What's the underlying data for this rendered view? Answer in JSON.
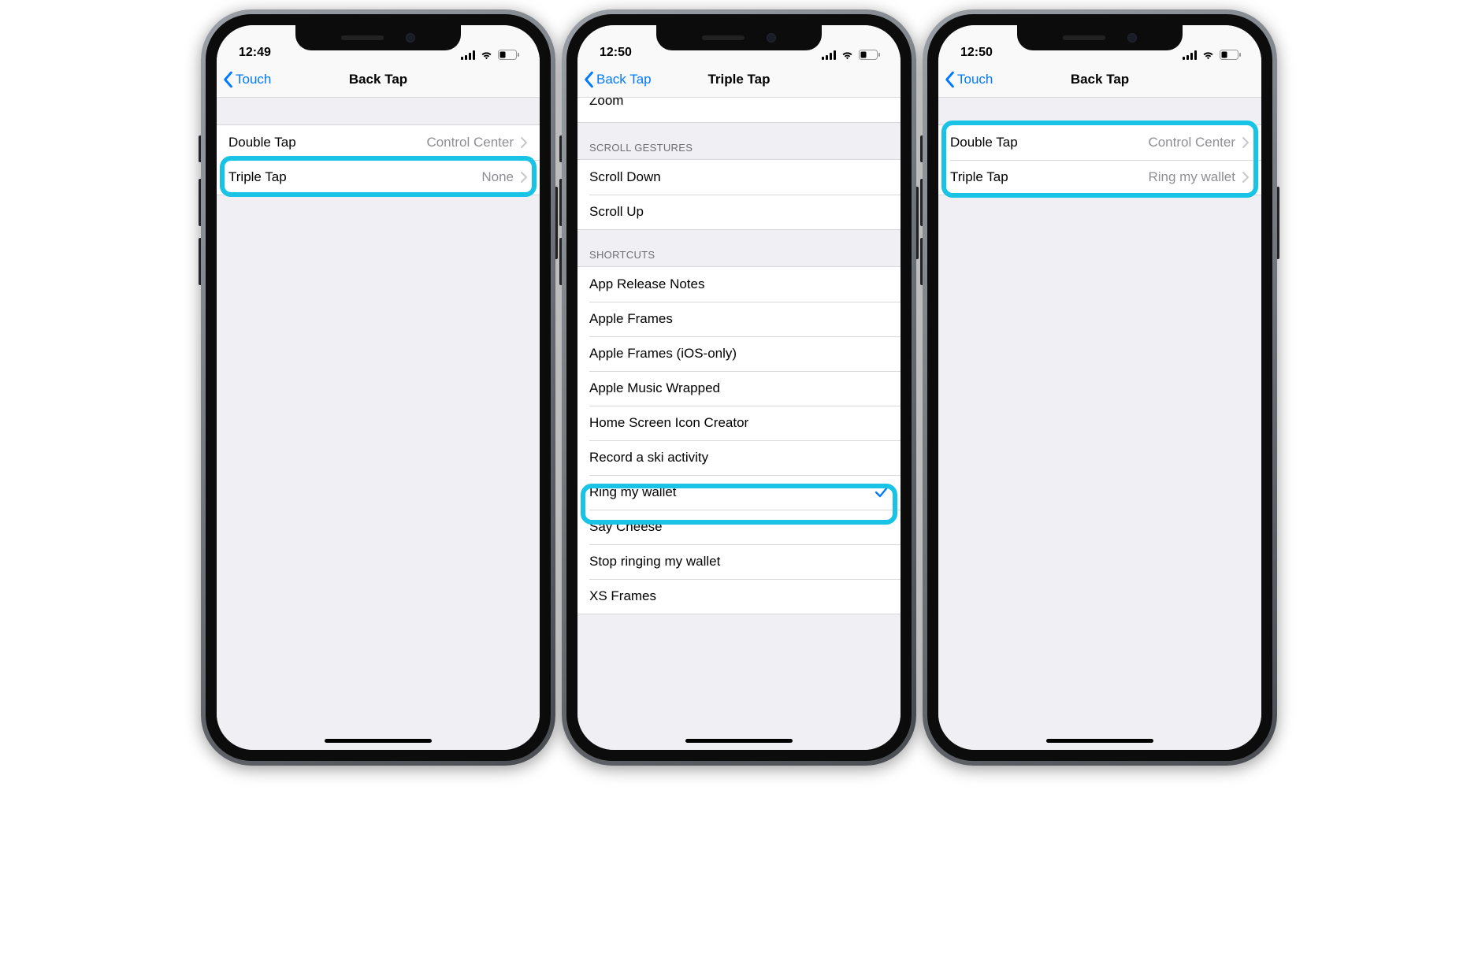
{
  "phones": [
    {
      "time": "12:49",
      "back_label": "Touch",
      "title": "Back Tap",
      "rows": [
        {
          "label": "Double Tap",
          "value": "Control Center"
        },
        {
          "label": "Triple Tap",
          "value": "None"
        }
      ]
    },
    {
      "time": "12:50",
      "back_label": "Back Tap",
      "title": "Triple Tap",
      "partial_top": "Zoom",
      "sections": [
        {
          "header": "Scroll Gestures",
          "items": [
            "Scroll Down",
            "Scroll Up"
          ]
        },
        {
          "header": "Shortcuts",
          "items": [
            "App Release Notes",
            "Apple Frames",
            "Apple Frames (iOS-only)",
            "Apple Music Wrapped",
            "Home Screen Icon Creator",
            "Record a ski activity",
            "Ring my wallet",
            "Say Cheese",
            "Stop ringing my wallet",
            "XS Frames"
          ]
        }
      ],
      "checked_item": "Ring my wallet"
    },
    {
      "time": "12:50",
      "back_label": "Touch",
      "title": "Back Tap",
      "rows": [
        {
          "label": "Double Tap",
          "value": "Control Center"
        },
        {
          "label": "Triple Tap",
          "value": "Ring my wallet"
        }
      ]
    }
  ],
  "colors": {
    "accent": "#007aff",
    "highlight": "#18c3e6"
  }
}
